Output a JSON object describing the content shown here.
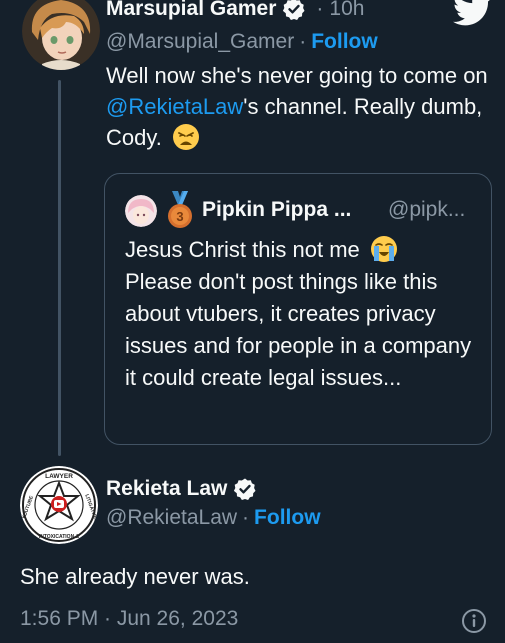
{
  "tweet1": {
    "display_name": "Marsupial Gamer",
    "time_sep": "·",
    "time": "10h",
    "handle": "@Marsupial_Gamer",
    "handle_sep": "·",
    "follow_label": "Follow",
    "text_before": "Well now she's never going to come on ",
    "mention": "@RekietaLaw",
    "text_after": "'s channel. Really dumb, Cody.",
    "emoji": "weary-face",
    "avatar": "anime-avatar"
  },
  "quote": {
    "display_name": "Pipkin Pippa ...",
    "handle": "@pipk...",
    "badge": "medal-3-icon",
    "text": "Jesus Christ this not me",
    "text_emoji": "loudly-crying-face",
    "text2": "Please don't post things like this about vtubers, it creates privacy issues and for people in a company it could create legal issues..."
  },
  "tweet2": {
    "display_name": "Rekieta Law",
    "handle": "@RekietaLaw",
    "handle_sep": "·",
    "follow_label": "Follow",
    "text": "She already never was.",
    "timestamp": "1:56 PM · Jun 26, 2023",
    "logo_text_top": "LAWYER",
    "logo_text_left": "YOUTUBE",
    "logo_text_right": "LITIGATION",
    "logo_text_bottom": "INTOXICATION &"
  },
  "colors": {
    "background": "#15202b",
    "accent": "#1d9bf0",
    "text": "#f7f9f9",
    "muted": "#8b98a5",
    "border": "#425364"
  }
}
